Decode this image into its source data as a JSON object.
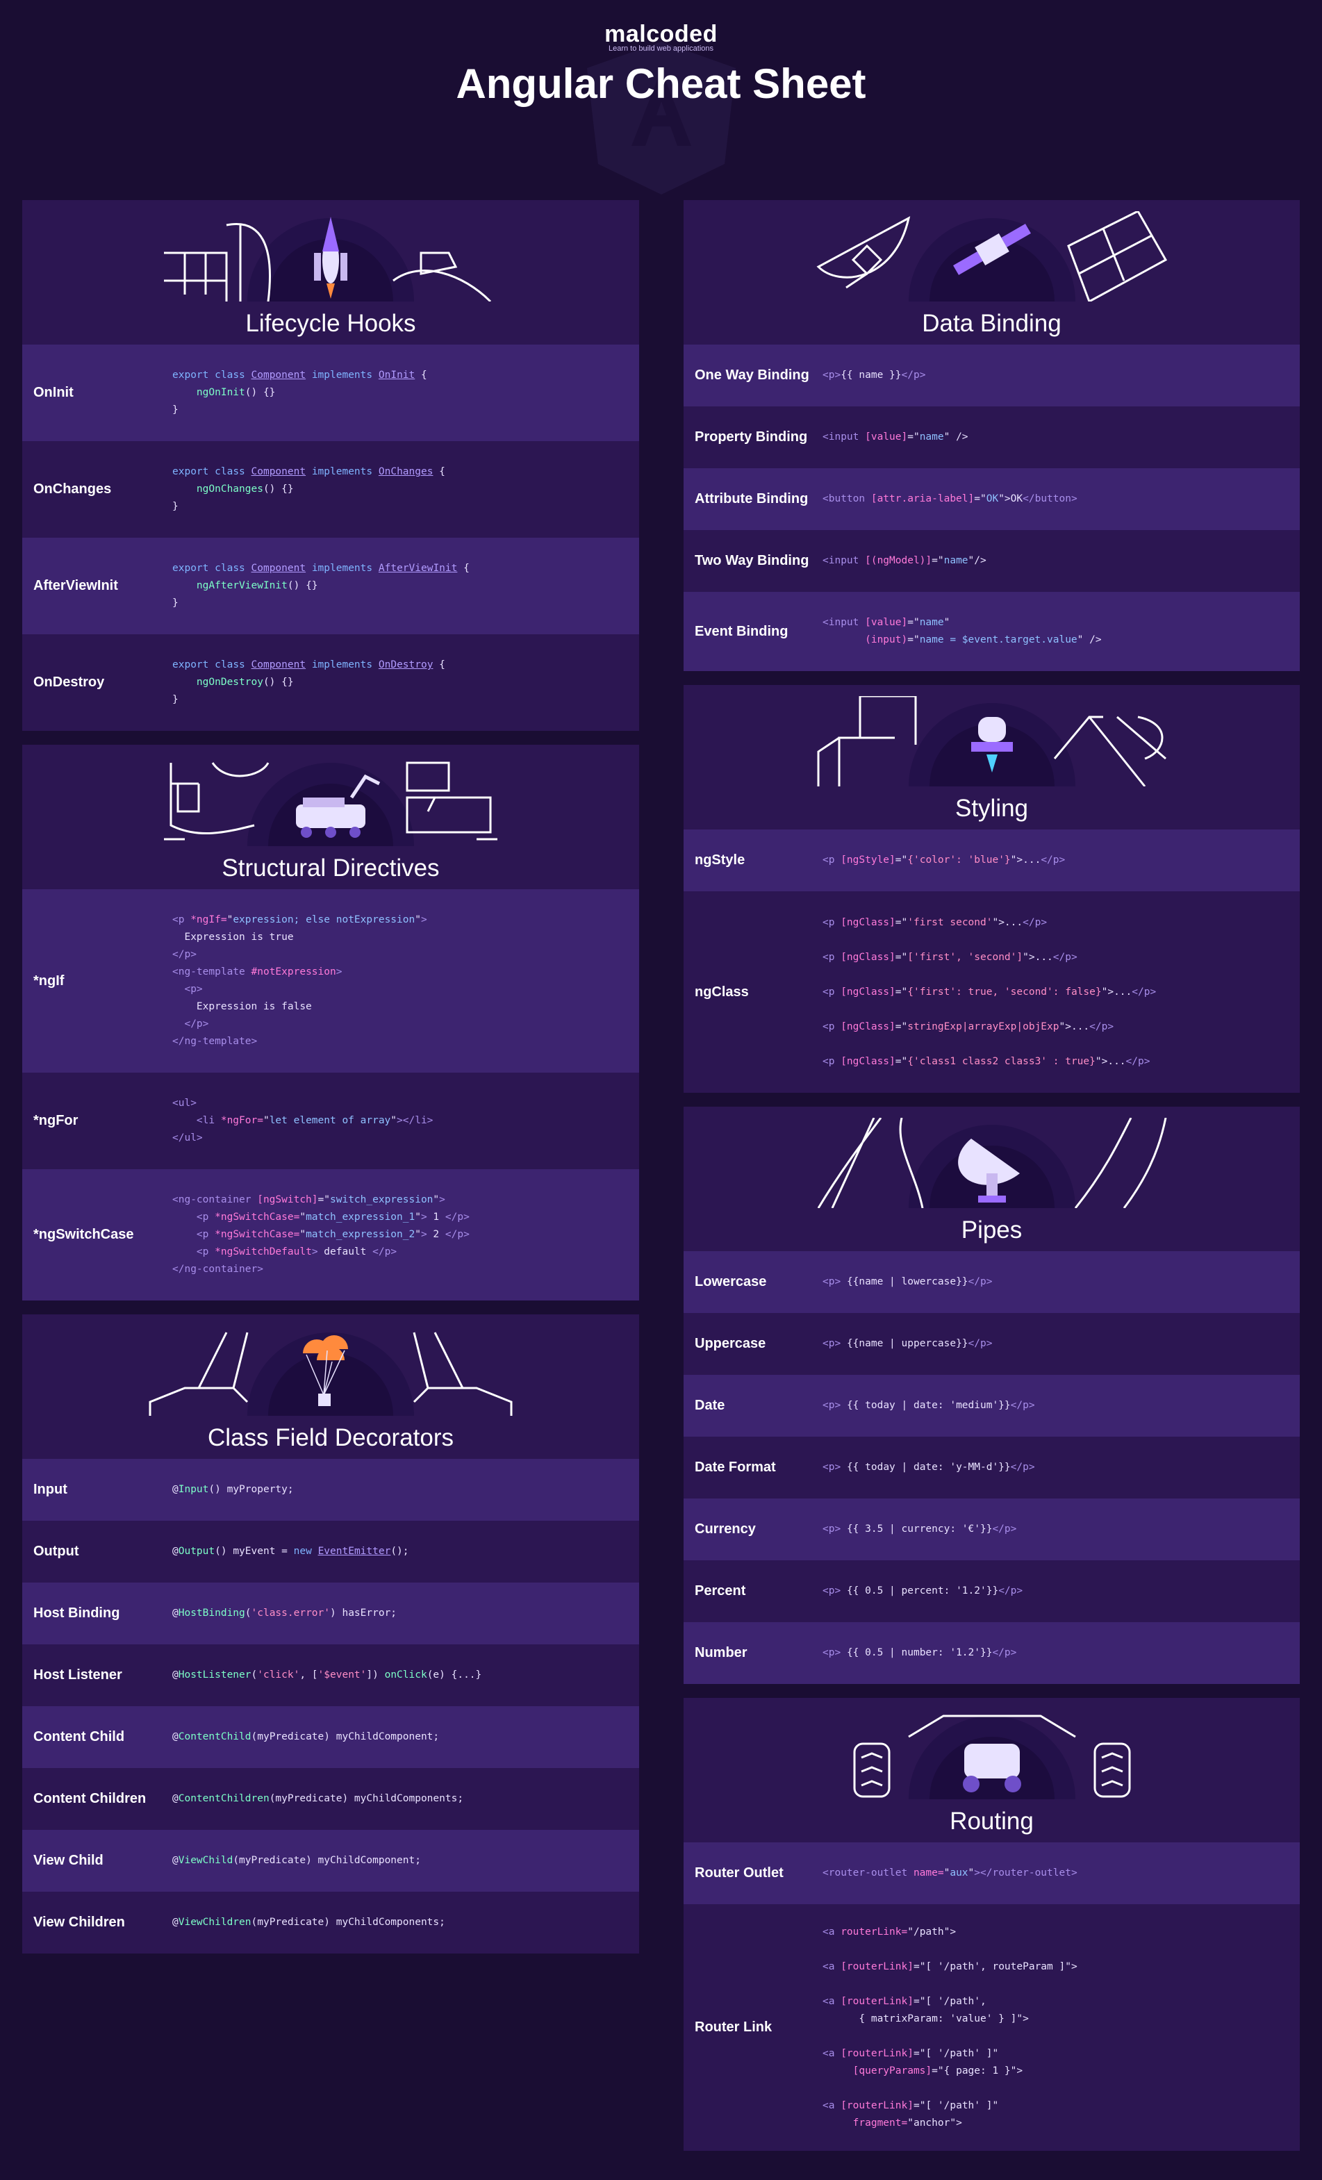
{
  "header": {
    "logo": "malcoded",
    "tagline": "Learn to build web applications",
    "title": "Angular Cheat Sheet"
  },
  "lifecycle": {
    "title": "Lifecycle Hooks",
    "rows": [
      {
        "label": "OnInit",
        "hook": "OnInit",
        "method": "ngOnInit"
      },
      {
        "label": "OnChanges",
        "hook": "OnChanges",
        "method": "ngOnChanges"
      },
      {
        "label": "AfterViewInit",
        "hook": "AfterViewInit",
        "method": "ngAfterViewInit"
      },
      {
        "label": "OnDestroy",
        "hook": "OnDestroy",
        "method": "ngOnDestroy"
      }
    ],
    "code": {
      "export": "export",
      "class": "class",
      "component": "Component",
      "implements": "implements",
      "tail": "() {}",
      "open": " {",
      "close": "}"
    }
  },
  "structural": {
    "title": "Structural Directives",
    "rows": [
      {
        "label": "*ngIf"
      },
      {
        "label": "*ngFor"
      },
      {
        "label": "*ngSwitchCase"
      }
    ],
    "ngif": {
      "l1": "expression; else notExpression",
      "l2": "Expression is true",
      "l4": "#notExpression",
      "l6": "Expression is false"
    },
    "ngfor": {
      "expr": "let element of array"
    },
    "ngswitch": {
      "expr": "switch_expression",
      "case1": "match_expression_1",
      "out1": " 1 ",
      "case2": "match_expression_2",
      "out2": " 2 ",
      "def": " default "
    }
  },
  "decorators": {
    "title": "Class Field Decorators",
    "rows": [
      {
        "label": "Input",
        "dec": "Input",
        "args": "()",
        "rest": " myProperty;"
      },
      {
        "label": "Output",
        "dec": "Output",
        "args": "()",
        "rest": " myEvent = "
      },
      {
        "label": "Host Binding",
        "dec": "HostBinding",
        "args": "'class.error'",
        "rest": ") hasError;"
      },
      {
        "label": "Host Listener",
        "dec": "HostListener",
        "args": "'click'",
        "rest": ""
      },
      {
        "label": "Content Child",
        "dec": "ContentChild",
        "args": "(myPredicate)",
        "rest": " myChildComponent;"
      },
      {
        "label": "Content Children",
        "dec": "ContentChildren",
        "args": "(myPredicate)",
        "rest": " myChildComponents;"
      },
      {
        "label": "View Child",
        "dec": "ViewChild",
        "args": "(myPredicate)",
        "rest": " myChildComponent;"
      },
      {
        "label": "View Children",
        "dec": "ViewChildren",
        "args": "(myPredicate)",
        "rest": " myChildComponents;"
      }
    ],
    "emitter": "EventEmitter",
    "listener_arg2": "'$event'",
    "listener_fn": "onClick",
    "listener_tail": "(e) {...}"
  },
  "binding": {
    "title": "Data Binding",
    "rows": [
      {
        "label": "One Way Binding"
      },
      {
        "label": "Property Binding"
      },
      {
        "label": "Attribute Binding"
      },
      {
        "label": "Two Way Binding"
      },
      {
        "label": "Event Binding"
      }
    ],
    "oneway": "{{ name }}",
    "prop_attr": "[value]",
    "prop_val": "name",
    "attr_attr": "[attr.aria-label]",
    "attr_val": "OK",
    "attr_text": "OK",
    "twoway_attr": "[(ngModel)]",
    "twoway_val": "name",
    "event_attr": "(input)",
    "event_val": "name = $event.target.value"
  },
  "styling": {
    "title": "Styling",
    "rows": [
      {
        "label": "ngStyle"
      },
      {
        "label": "ngClass"
      }
    ],
    "ngstyle": "{'color': 'blue'}",
    "ngclass": [
      "'first second'",
      "['first', 'second']",
      "{'first': true, 'second': false}",
      "stringExp|arrayExp|objExp",
      "{'class1 class2 class3' : true}"
    ]
  },
  "pipes": {
    "title": "Pipes",
    "rows": [
      {
        "label": "Lowercase",
        "code": "{{name | lowercase}}"
      },
      {
        "label": "Uppercase",
        "code": "{{name | uppercase}}"
      },
      {
        "label": "Date",
        "code": "{{ today | date: 'medium'}}"
      },
      {
        "label": "Date Format",
        "code": "{{ today | date: 'y-MM-d'}}"
      },
      {
        "label": "Currency",
        "code": "{{ 3.5 | currency: '€'}}"
      },
      {
        "label": "Percent",
        "code": "{{ 0.5 | percent: '1.2'}}"
      },
      {
        "label": "Number",
        "code": "{{ 0.5 | number: '1.2'}}"
      }
    ]
  },
  "routing": {
    "title": "Routing",
    "rows": [
      {
        "label": "Router Outlet"
      },
      {
        "label": "Router Link"
      }
    ],
    "outlet_name": "aux",
    "links": [
      "/path",
      "[ '/path', routeParam ]",
      "[ '/path',",
      "{ matrixParam: 'value' } ]",
      "[ '/path' ]",
      "{ page: 1 }",
      "[ '/path' ]",
      "anchor"
    ]
  },
  "colors": {
    "background": "#1a0d33",
    "card": "#2c1652",
    "row_highlight": "#3d2470",
    "keyword": "#7fb4ff",
    "function": "#7dffc8",
    "attribute": "#ff7ad9"
  }
}
